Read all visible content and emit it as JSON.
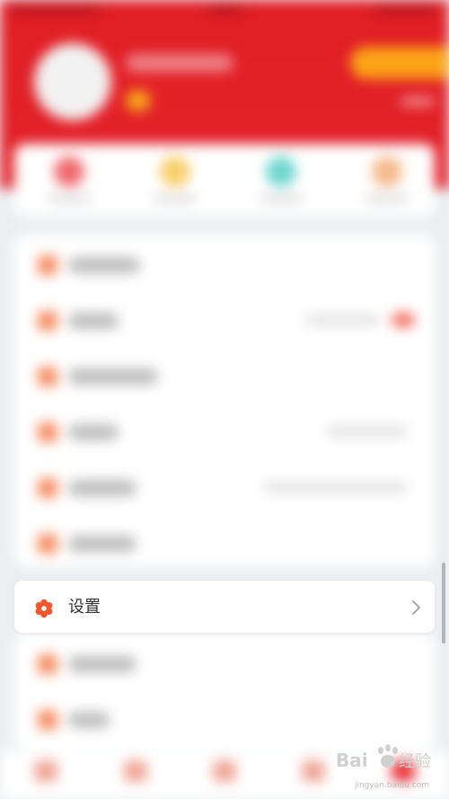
{
  "settings_row": {
    "label": "设置",
    "icon": "gear-icon",
    "chevron_icon": "chevron-right-icon"
  },
  "watermark": {
    "brand": "Bai",
    "brand_suffix": "经验",
    "url": "jingyan.baidu.com"
  },
  "colors": {
    "header_red": "#e2222a",
    "accent_orange": "#f0572b",
    "vip_yellow": "#fca418"
  }
}
